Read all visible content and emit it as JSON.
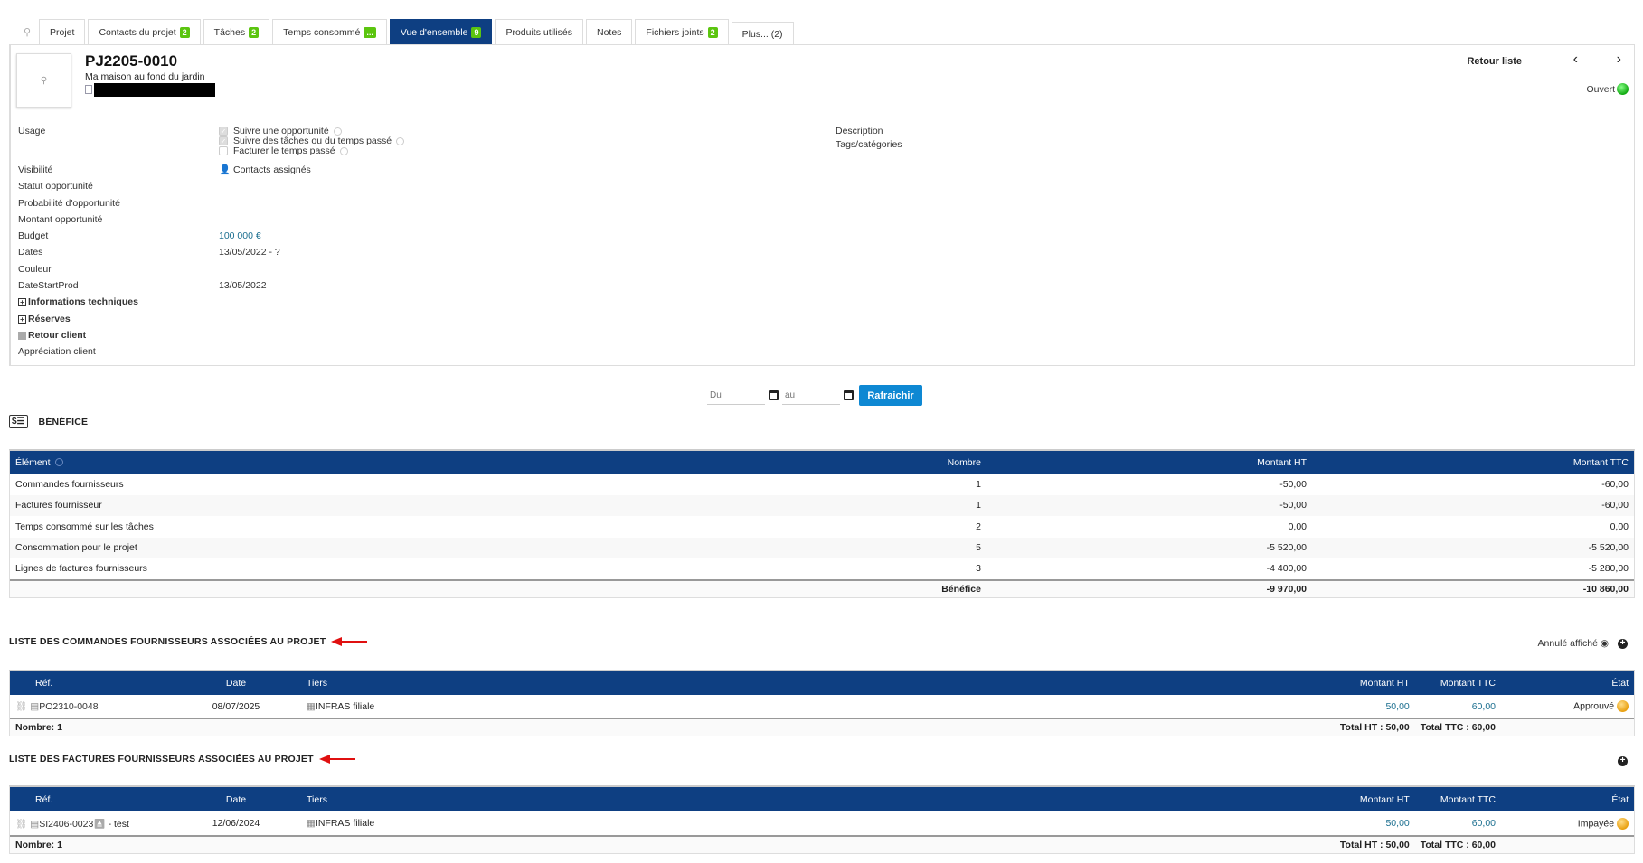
{
  "tabs": [
    {
      "label": "Projet"
    },
    {
      "label": "Contacts du projet",
      "badge": "2"
    },
    {
      "label": "Tâches",
      "badge": "2"
    },
    {
      "label": "Temps consommé",
      "badge": "..."
    },
    {
      "label": "Vue d'ensemble",
      "badge": "9"
    },
    {
      "label": "Produits utilisés"
    },
    {
      "label": "Notes"
    },
    {
      "label": "Fichiers joints",
      "badge": "2"
    },
    {
      "label": "Plus... (2)"
    }
  ],
  "header": {
    "ref": "PJ2205-0010",
    "label": "Ma maison au fond du jardin",
    "back": "Retour liste",
    "status": "Ouvert"
  },
  "fields": {
    "usage": "Usage",
    "usage_opts": [
      "Suivre une opportunité",
      "Suivre des tâches ou du temps passé",
      "Facturer le temps passé"
    ],
    "visibility": "Visibilité",
    "visibility_val": "Contacts assignés",
    "opp_status": "Statut opportunité",
    "opp_prob": "Probabilité d'opportunité",
    "opp_amount": "Montant opportunité",
    "budget": "Budget",
    "budget_val": "100 000 €",
    "dates": "Dates",
    "dates_val": "13/05/2022 - ?",
    "color": "Couleur",
    "datestart": "DateStartProd",
    "datestart_val": "13/05/2022",
    "tech": "Informations techniques",
    "reserves": "Réserves",
    "retour": "Retour client",
    "appreciation": "Appréciation client",
    "description": "Description",
    "tags": "Tags/catégories"
  },
  "filter": {
    "from_ph": "Du",
    "to_ph": "au",
    "refresh": "Rafraichir"
  },
  "benefit": {
    "title": "BÉNÉFICE",
    "headers": [
      "Élément",
      "Nombre",
      "Montant HT",
      "Montant TTC"
    ],
    "rows": [
      [
        "Commandes fournisseurs",
        "1",
        "-50,00",
        "-60,00"
      ],
      [
        "Factures fournisseur",
        "1",
        "-50,00",
        "-60,00"
      ],
      [
        "Temps consommé sur les tâches",
        "2",
        "0,00",
        "0,00"
      ],
      [
        "Consommation pour le projet",
        "5",
        "-5 520,00",
        "-5 520,00"
      ],
      [
        "Lignes de factures fournisseurs",
        "3",
        "-4 400,00",
        "-5 280,00"
      ]
    ],
    "total_label": "Bénéfice",
    "total_ht": "-9 970,00",
    "total_ttc": "-10 860,00"
  },
  "orders": {
    "title": "LISTE DES COMMANDES FOURNISSEURS ASSOCIÉES AU PROJET",
    "cancel_shown": "Annulé affiché",
    "headers": [
      "Réf.",
      "Date",
      "Tiers",
      "Montant HT",
      "Montant TTC",
      "État"
    ],
    "row": {
      "ref": "PO2310-0048",
      "date": "08/07/2025",
      "tiers": "INFRAS filiale",
      "ht": "50,00",
      "ttc": "60,00",
      "state": "Approuvé"
    },
    "count": "Nombre: 1",
    "total_ht": "Total HT : 50,00",
    "total_ttc": "Total TTC : 60,00"
  },
  "invoices": {
    "title": "LISTE DES FACTURES FOURNISSEURS ASSOCIÉES AU PROJET",
    "headers": [
      "Réf.",
      "Date",
      "Tiers",
      "Montant HT",
      "Montant TTC",
      "État"
    ],
    "row": {
      "ref": "SI2406-0023",
      "suffix": "- test",
      "date": "12/06/2024",
      "tiers": "INFRAS filiale",
      "ht": "50,00",
      "ttc": "60,00",
      "state": "Impayée"
    },
    "count": "Nombre: 1",
    "total_ht": "Total HT : 50,00",
    "total_ttc": "Total TTC : 60,00"
  },
  "colors": {
    "header": "#0e3f82",
    "badge": "#5bc50f",
    "button": "#0e88d3",
    "open": "#22b322",
    "pending": "#f0b020",
    "arrow": "#e01010"
  }
}
